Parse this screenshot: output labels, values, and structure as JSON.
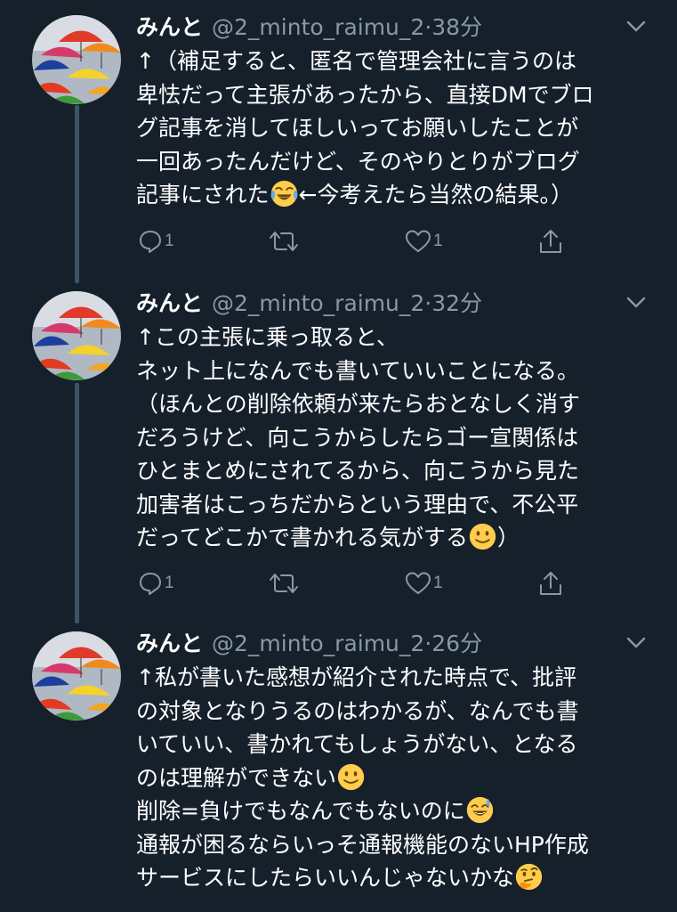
{
  "colors": {
    "background": "#15202b",
    "secondary_text": "#8899a6",
    "thread_line": "#3d5466"
  },
  "tweets": [
    {
      "name": "みんと",
      "handle": "@2_minto_raimu_2",
      "separator": "·",
      "time": "38分",
      "lines": [
        "↑（補足すると、匿名で管理会社に言うのは",
        "卑怯だって主張があったから、直接DMでブロ",
        "グ記事を消してほしいってお願いしたことが",
        "一回あったんだけど、そのやりとりがブログ",
        "記事にされた",
        "←今考えたら当然の結果。）"
      ],
      "emoji": [
        "face-with-tears-of-joy"
      ],
      "reply_count": "1",
      "retweet_count": "",
      "like_count": "1"
    },
    {
      "name": "みんと",
      "handle": "@2_minto_raimu_2",
      "separator": "·",
      "time": "32分",
      "lines": [
        "↑この主張に乗っ取ると、",
        "ネット上になんでも書いていいことになる。",
        "（ほんとの削除依頼が来たらおとなしく消す",
        "だろうけど、向こうからしたらゴー宣関係は",
        "ひとまとめにされてるから、向こうから見た",
        "加害者はこっちだからという理由で、不公平",
        "だってどこかで書かれる気がする",
        "）"
      ],
      "emoji": [
        "slightly-smiling-face"
      ],
      "reply_count": "1",
      "retweet_count": "",
      "like_count": "1"
    },
    {
      "name": "みんと",
      "handle": "@2_minto_raimu_2",
      "separator": "·",
      "time": "26分",
      "lines": [
        "↑私が書いた感想が紹介された時点で、批評",
        "の対象となりうるのはわかるが、なんでも書",
        "いていい、書かれてもしょうがない、となる",
        "のは理解ができない",
        "削除=負けでもなんでもないのに",
        "通報が困るならいっそ通報機能のないHP作成",
        "サービスにしたらいいんじゃないかな"
      ],
      "emoji": [
        "slightly-smiling-face",
        "grinning-face-with-sweat",
        "thinking-face"
      ]
    }
  ]
}
